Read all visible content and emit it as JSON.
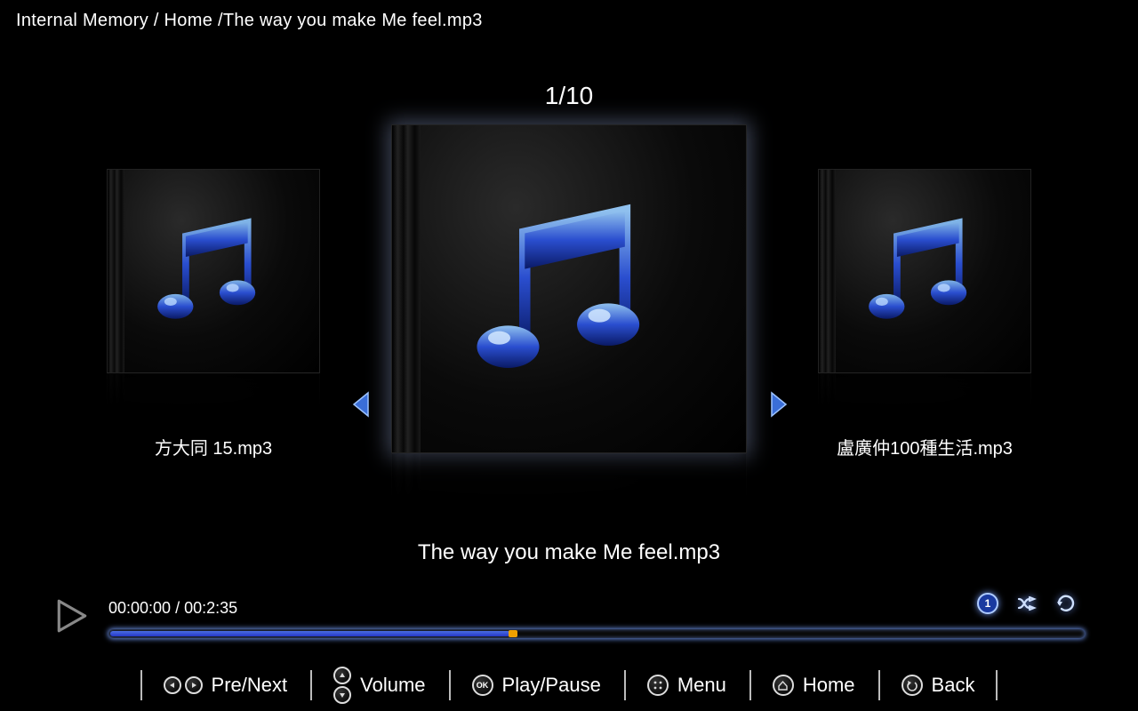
{
  "breadcrumb": "Internal Memory / Home /The way you make Me feel.mp3",
  "counter": "1/10",
  "tracks": {
    "prev": {
      "title": "方大同 15.mp3"
    },
    "current": {
      "title": "The way you make Me feel.mp3"
    },
    "next": {
      "title": "盧廣仲100種生活.mp3"
    }
  },
  "playback": {
    "elapsed": "00:00:00",
    "sep": " / ",
    "duration": "00:2:35",
    "repeat_badge": "1"
  },
  "hints": {
    "prenext": "Pre/Next",
    "volume": "Volume",
    "playpause": "Play/Pause",
    "menu": "Menu",
    "home": "Home",
    "back": "Back",
    "ok": "OK"
  }
}
